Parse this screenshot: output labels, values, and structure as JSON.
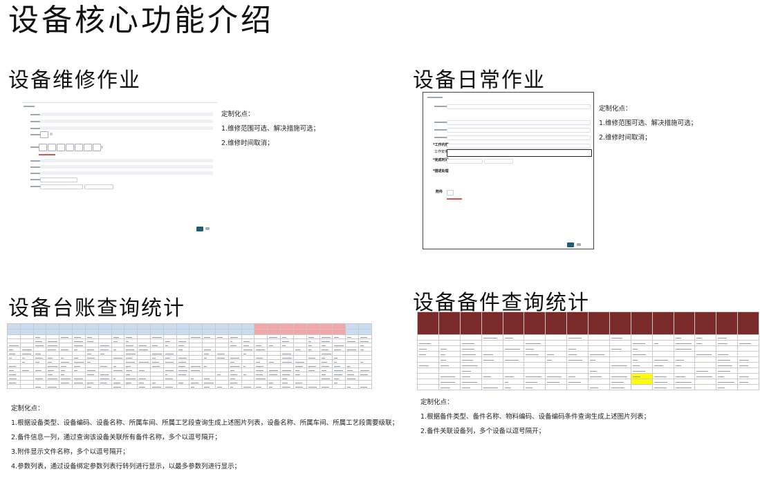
{
  "page": {
    "title": "设备核心功能介绍"
  },
  "sections": {
    "maintenance": {
      "title": "设备维修作业",
      "notes": [
        "定制化点：",
        "1.维修范围可选、解决措施可选；",
        "2.维修时间取消；"
      ]
    },
    "daily": {
      "title": "设备日常作业",
      "form": {
        "labels": [
          "*工作内容",
          "工作安排",
          "*完成时间",
          "*描述处理",
          "附件"
        ]
      },
      "notes": [
        "定制化点：",
        "1.维修范围可选、解决措施可选；",
        "2.维修时间取消；"
      ]
    },
    "ledger": {
      "title": "设备台账查询统计",
      "notes": [
        "定制化点：",
        "1.根据设备类型、设备编码、设备名称、所属车间、所属工艺段查询生成上述图片列表，设备名称、所属车间、所属工艺段需要级联；",
        "2.备件信息一列，通过查询该设备关联所有备件名称，多个以逗号隔开；",
        "3.附件显示文件名称，多个以逗号隔开；",
        "4.参数列表，通过设备绑定参数列表行转列进行显示，以最多参数列进行显示；"
      ]
    },
    "spares": {
      "title": "设备备件查询统计",
      "notes": [
        "定制化点：",
        "1.根据备件类型、备件名称、物料编码、设备编码条件查询生成上述图片列表；",
        "2.备件关联设备列，多个设备以逗号隔开；"
      ]
    }
  },
  "colors": {
    "table_header_blue": "#c9dcf2",
    "table_header_red": "#f2a6a6",
    "spares_header": "#7b2a2a",
    "highlight_yellow": "#ffff00",
    "button_teal": "#1e5f73"
  },
  "icons": [
    "maintenance-form-thumbnail",
    "daily-form-thumbnail",
    "ledger-table-thumbnail",
    "spares-table-thumbnail"
  ]
}
